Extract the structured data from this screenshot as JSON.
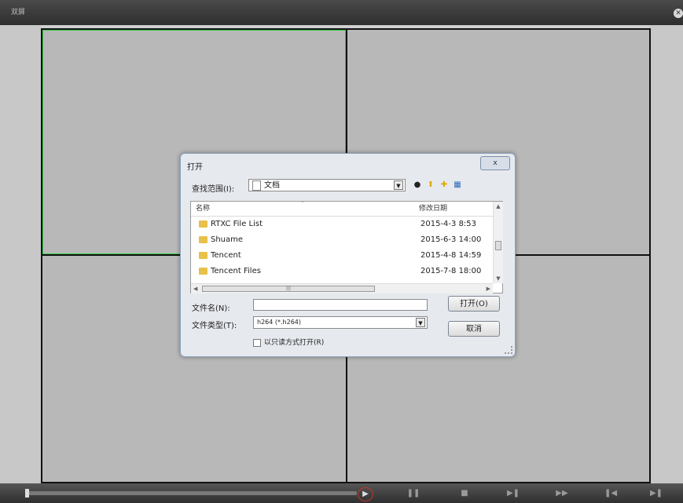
{
  "window": {
    "title": "双屏"
  },
  "dialog": {
    "title": "打开",
    "close_label": "ⅹ",
    "lookin_label": "查找范围(I):",
    "lookin_value": "文档",
    "columns": {
      "name": "名称",
      "date": "修改日期"
    },
    "files": [
      {
        "name": "RTXC File List",
        "date": "2015-4-3 8:53"
      },
      {
        "name": "Shuame",
        "date": "2015-6-3 14:00"
      },
      {
        "name": "Tencent",
        "date": "2015-4-8 14:59"
      },
      {
        "name": "Tencent Files",
        "date": "2015-7-8 18:00"
      }
    ],
    "filename_label": "文件名(N):",
    "filename_value": "",
    "filetype_label": "文件类型(T):",
    "filetype_value": "h264 (*.h264)",
    "open_button": "打开(O)",
    "cancel_button": "取消",
    "readonly_label": "以只读方式打开(R)"
  },
  "colors": {
    "selected_pane_border": "#2ecc40",
    "play_highlight": "#c0392b",
    "folder": "#e8c14a"
  },
  "icons": [
    "close-icon",
    "play-icon",
    "pause-icon",
    "stop-icon",
    "step-icon",
    "fast-forward-icon",
    "prev-icon",
    "next-icon",
    "back-icon",
    "new-folder-icon",
    "view-menu-icon",
    "folder-icon",
    "document-icon"
  ]
}
